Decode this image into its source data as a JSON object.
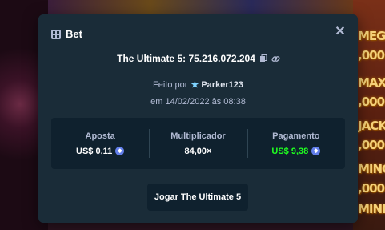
{
  "background": {
    "slots": [
      "MEGA",
      ",000",
      "MAX",
      ",000",
      "JACKO",
      ",000",
      "MINO",
      ",000",
      "MINI"
    ]
  },
  "modal": {
    "title": "Bet",
    "title_icon": "calculator-icon",
    "close_icon": "close-icon",
    "bet_id": "The Ultimate 5: 75.216.072.204",
    "copy_icon": "copy-icon",
    "link_icon": "link-icon",
    "placed_by_prefix": "Feito por",
    "user_icon": "vip-star-icon",
    "username": "Parker123",
    "date": "em 14/02/2022 às 08:38",
    "stats": {
      "bet_label": "Aposta",
      "bet_value": "US$ 0,11",
      "multiplier_label": "Multiplicador",
      "multiplier_value": "84,00×",
      "payout_label": "Pagamento",
      "payout_value": "US$ 9,38",
      "coin_icon": "ethereum-coin-icon"
    },
    "play_button": "Jogar The Ultimate 5"
  },
  "colors": {
    "modal_bg": "#1a2c38",
    "panel_bg": "#0f212e",
    "payout_green": "#1fff20",
    "muted_text": "#b1bad3"
  }
}
